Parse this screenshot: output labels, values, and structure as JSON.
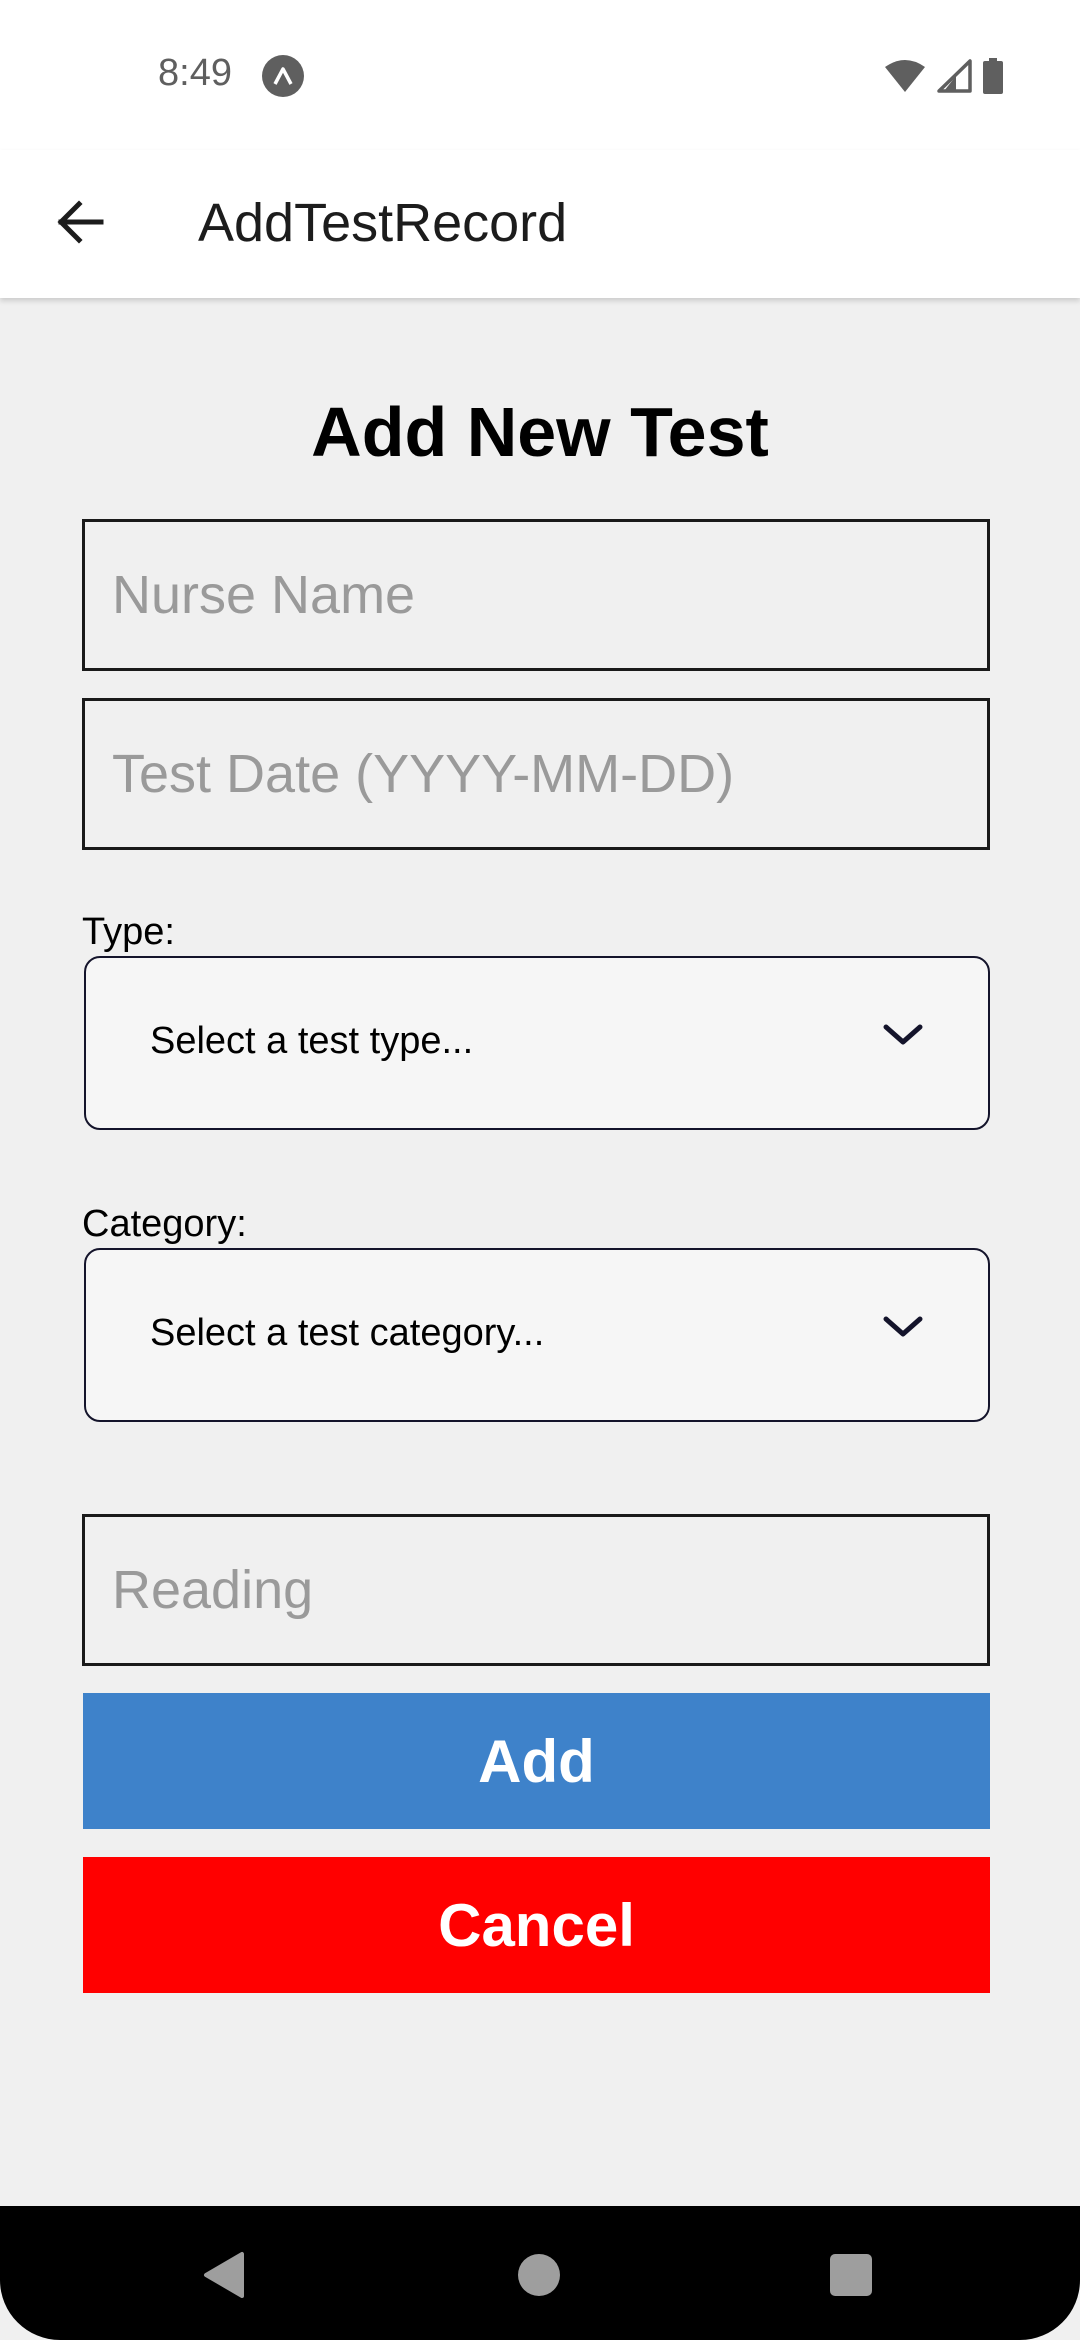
{
  "status_bar": {
    "time": "8:49",
    "app_icon": "expo-icon",
    "wifi_icon": "wifi-icon",
    "signal_icon": "signal-icon",
    "battery_icon": "battery-icon"
  },
  "app_bar": {
    "title": "AddTestRecord",
    "back_icon": "arrow-left-icon"
  },
  "form": {
    "title": "Add New Test",
    "nurse_name_placeholder": "Nurse Name",
    "test_date_placeholder": "Test Date (YYYY-MM-DD)",
    "type_label": "Type:",
    "type_value": "Select a test type...",
    "category_label": "Category:",
    "category_value": "Select a test category...",
    "reading_placeholder": "Reading",
    "add_label": "Add",
    "cancel_label": "Cancel"
  },
  "colors": {
    "add_button": "#3e82ca",
    "cancel_button": "#ff0000",
    "background": "#f0f0f0"
  },
  "nav_bar": {
    "back_icon": "triangle-back-icon",
    "home_icon": "circle-home-icon",
    "recents_icon": "square-recents-icon"
  }
}
